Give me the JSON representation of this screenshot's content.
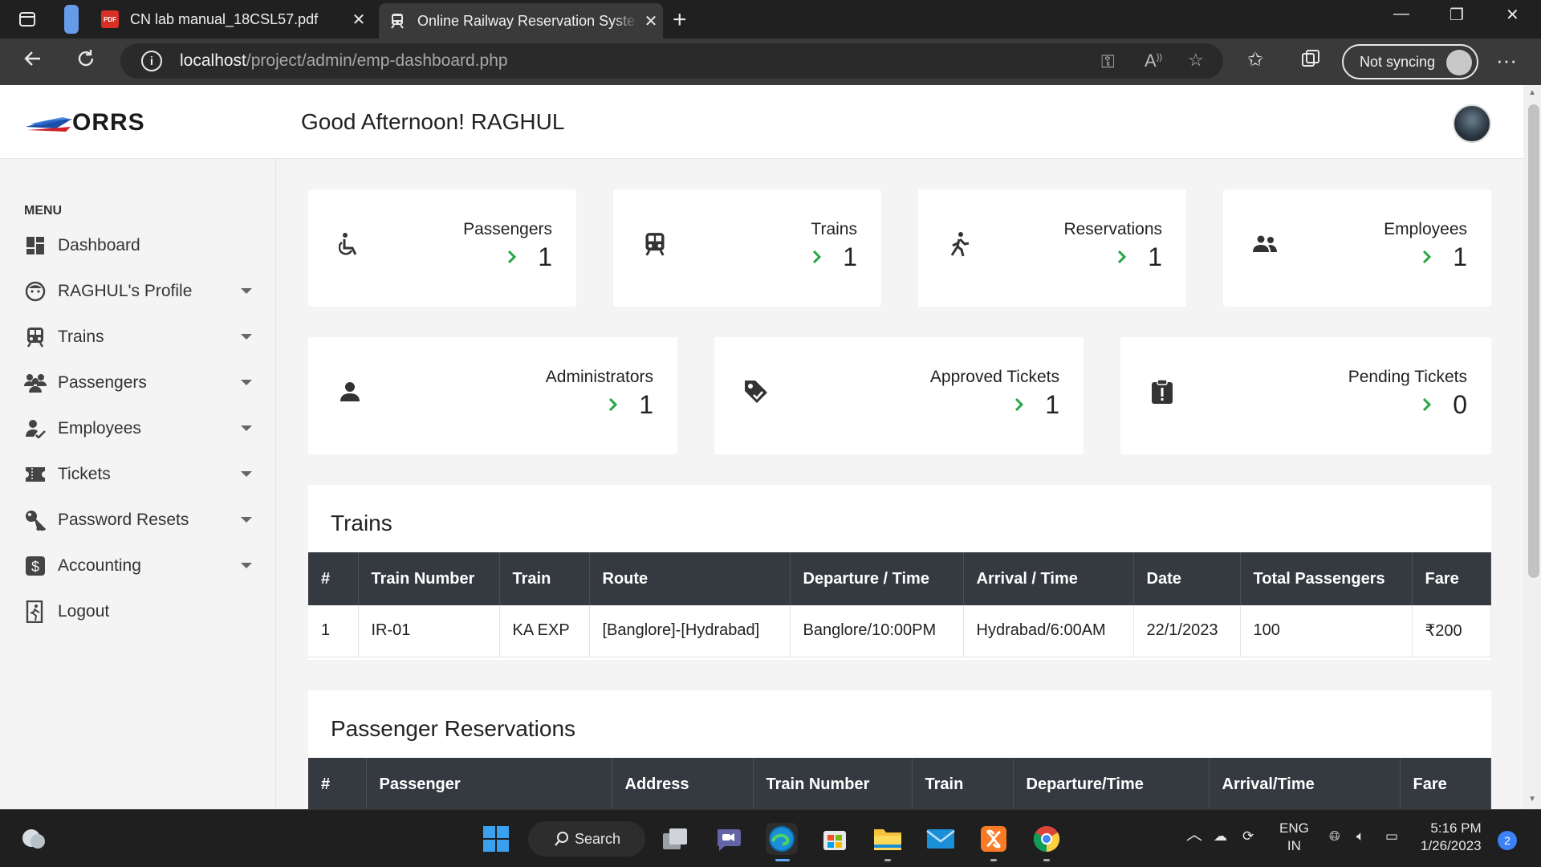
{
  "browser": {
    "tabs": [
      {
        "title": "CN lab manual_18CSL57.pdf",
        "favicon": "PDF"
      },
      {
        "title": "Online Railway Reservation Syste",
        "favicon": "train"
      }
    ],
    "url_host": "localhost",
    "url_path": "/project/admin/emp-dashboard.php",
    "sync_label": "Not syncing"
  },
  "header": {
    "logo_text": "ORRS",
    "greeting": "Good Afternoon! RAGHUL"
  },
  "sidebar": {
    "menu_title": "MENU",
    "items": [
      {
        "label": "Dashboard",
        "icon": "dashboard-icon",
        "caret": false
      },
      {
        "label": "RAGHUL's Profile",
        "icon": "profile-icon",
        "caret": true
      },
      {
        "label": "Trains",
        "icon": "train-icon",
        "caret": true
      },
      {
        "label": "Passengers",
        "icon": "people-icon",
        "caret": true
      },
      {
        "label": "Employees",
        "icon": "employee-icon",
        "caret": true
      },
      {
        "label": "Tickets",
        "icon": "ticket-icon",
        "caret": true
      },
      {
        "label": "Password Resets",
        "icon": "key-icon",
        "caret": true
      },
      {
        "label": "Accounting",
        "icon": "dollar-icon",
        "caret": true
      },
      {
        "label": "Logout",
        "icon": "logout-icon",
        "caret": false
      }
    ]
  },
  "stats_row1": [
    {
      "label": "Passengers",
      "value": "1",
      "icon": "wheelchair-icon"
    },
    {
      "label": "Trains",
      "value": "1",
      "icon": "train-icon"
    },
    {
      "label": "Reservations",
      "value": "1",
      "icon": "walking-icon"
    },
    {
      "label": "Employees",
      "value": "1",
      "icon": "users-icon"
    }
  ],
  "stats_row2": [
    {
      "label": "Administrators",
      "value": "1",
      "icon": "user-icon"
    },
    {
      "label": "Approved Tickets",
      "value": "1",
      "icon": "tag-icon"
    },
    {
      "label": "Pending Tickets",
      "value": "0",
      "icon": "clipboard-alert-icon"
    }
  ],
  "trains_table": {
    "title": "Trains",
    "headers": [
      "#",
      "Train Number",
      "Train",
      "Route",
      "Departure / Time",
      "Arrival / Time",
      "Date",
      "Total Passengers",
      "Fare"
    ],
    "rows": [
      [
        "1",
        "IR-01",
        "KA EXP",
        "[Banglore]-[Hydrabad]",
        "Banglore/10:00PM",
        "Hydrabad/6:00AM",
        "22/1/2023",
        "100",
        "₹200"
      ]
    ]
  },
  "reservations_table": {
    "title": "Passenger Reservations",
    "headers": [
      "#",
      "Passenger",
      "Address",
      "Train Number",
      "Train",
      "Departure/Time",
      "Arrival/Time",
      "Fare"
    ]
  },
  "taskbar": {
    "search_label": "Search",
    "lang_top": "ENG",
    "lang_bottom": "IN",
    "time": "5:16 PM",
    "date": "1/26/2023",
    "notifications": "2"
  },
  "colors": {
    "accent_green": "#28a745",
    "table_header_bg": "#343a40"
  }
}
